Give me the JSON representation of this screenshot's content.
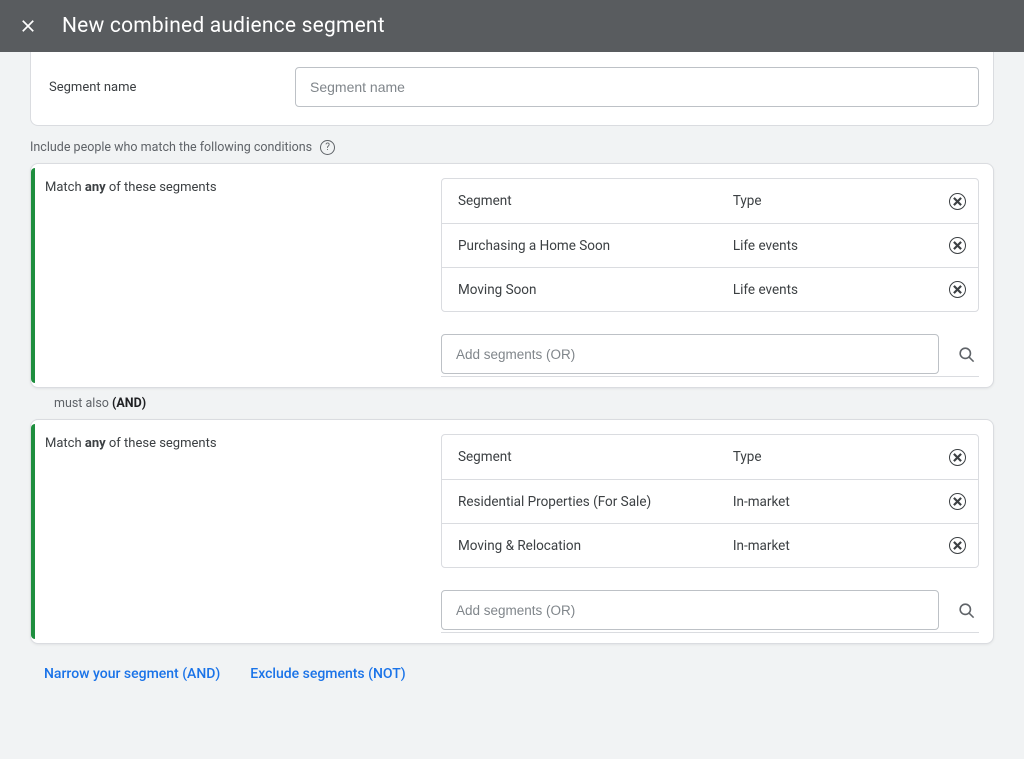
{
  "header": {
    "title": "New combined audience segment"
  },
  "segment_name": {
    "label": "Segment name",
    "placeholder": "Segment name",
    "value": ""
  },
  "include_label": "Include people who match the following conditions",
  "match_any": {
    "prefix": "Match ",
    "bold": "any",
    "suffix": " of these segments"
  },
  "columns": {
    "segment": "Segment",
    "type": "Type"
  },
  "blocks": [
    {
      "rows": [
        {
          "name": "Purchasing a Home Soon",
          "type": "Life events"
        },
        {
          "name": "Moving Soon",
          "type": "Life events"
        }
      ],
      "add_placeholder": "Add segments (OR)"
    },
    {
      "rows": [
        {
          "name": "Residential Properties (For Sale)",
          "type": "In-market"
        },
        {
          "name": "Moving & Relocation",
          "type": "In-market"
        }
      ],
      "add_placeholder": "Add segments (OR)"
    }
  ],
  "connector": {
    "prefix": "must also ",
    "bold": "(AND)"
  },
  "footer": {
    "narrow": "Narrow your segment (AND)",
    "exclude": "Exclude segments (NOT)"
  }
}
